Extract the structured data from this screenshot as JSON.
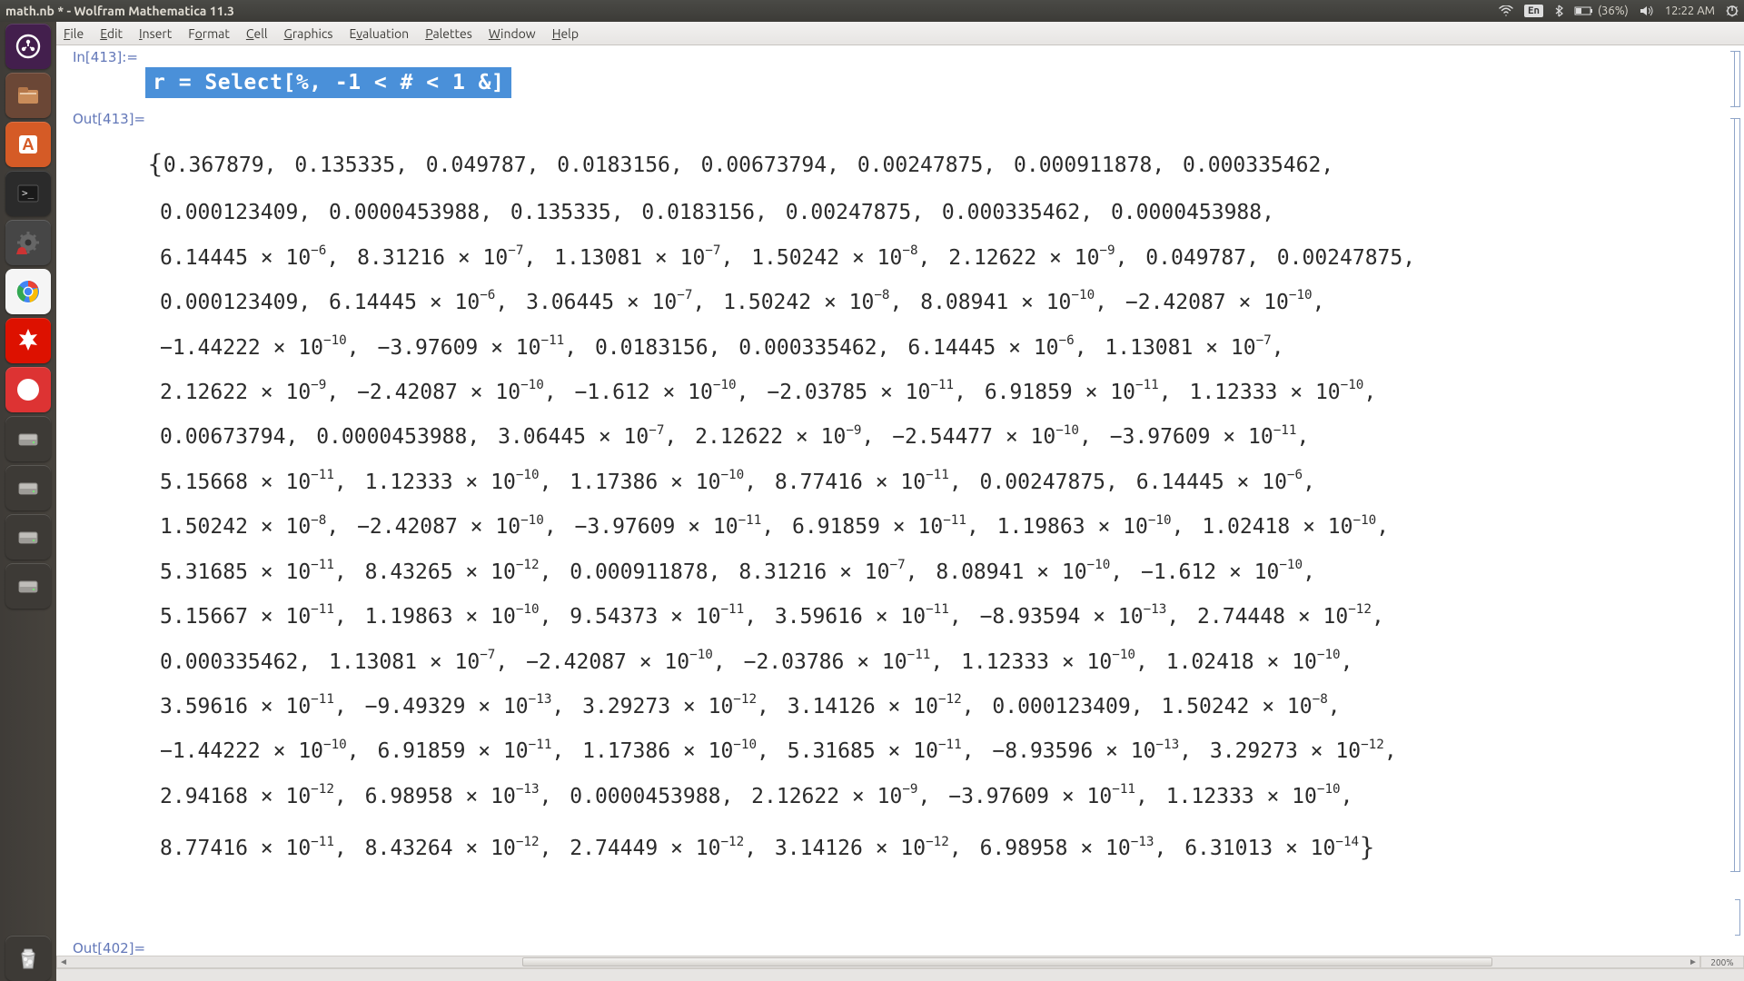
{
  "titlebar": {
    "title": "math.nb * - Wolfram Mathematica 11.3",
    "indicators": {
      "lang": "En",
      "battery": "(36%)",
      "time": "12:22 AM"
    }
  },
  "menubar": [
    "File",
    "Edit",
    "Insert",
    "Format",
    "Cell",
    "Graphics",
    "Evaluation",
    "Palettes",
    "Window",
    "Help"
  ],
  "launcher": {
    "items": [
      {
        "name": "dash-icon",
        "bg": "#431f4d"
      },
      {
        "name": "files-icon",
        "bg": "#6b4736"
      },
      {
        "name": "software-center-icon",
        "bg": "#d55b26"
      },
      {
        "name": "terminal-icon",
        "bg": "#2b2b2b"
      },
      {
        "name": "settings-icon",
        "bg": "#464646"
      },
      {
        "name": "chrome-icon",
        "bg": "#f5f5f5"
      },
      {
        "name": "mathematica-icon",
        "bg": "#dd1100"
      },
      {
        "name": "evince-icon",
        "bg": "#d33"
      },
      {
        "name": "drive-icon-1",
        "bg": "#3d3a36"
      },
      {
        "name": "drive-icon-2",
        "bg": "#3d3a36"
      },
      {
        "name": "drive-icon-3",
        "bg": "#3d3a36"
      },
      {
        "name": "drive-icon-4",
        "bg": "#3d3a36"
      }
    ],
    "trash": {
      "name": "trash-icon",
      "bg": "#3d3a36"
    }
  },
  "notebook": {
    "in_label": "In[413]:=",
    "input_code": "r = Select[%, -1 < # < 1 &]",
    "out_label": "Out[413]=",
    "out402_label": "Out[402]=",
    "zoom": "200%",
    "output_rows": [
      [
        {
          "t": "brace",
          "v": "{"
        },
        {
          "t": "n",
          "v": "0.367879"
        },
        {
          "t": "n",
          "v": "0.135335"
        },
        {
          "t": "n",
          "v": "0.049787"
        },
        {
          "t": "n",
          "v": "0.0183156"
        },
        {
          "t": "n",
          "v": "0.00673794"
        },
        {
          "t": "n",
          "v": "0.00247875"
        },
        {
          "t": "n",
          "v": "0.000911878"
        },
        {
          "t": "n",
          "v": "0.000335462"
        }
      ],
      [
        {
          "t": "n",
          "v": "0.000123409"
        },
        {
          "t": "n",
          "v": "0.0000453988"
        },
        {
          "t": "n",
          "v": "0.135335"
        },
        {
          "t": "n",
          "v": "0.0183156"
        },
        {
          "t": "n",
          "v": "0.00247875"
        },
        {
          "t": "n",
          "v": "0.000335462"
        },
        {
          "t": "n",
          "v": "0.0000453988"
        }
      ],
      [
        {
          "t": "s",
          "m": "6.14445",
          "e": "-6"
        },
        {
          "t": "s",
          "m": "8.31216",
          "e": "-7"
        },
        {
          "t": "s",
          "m": "1.13081",
          "e": "-7"
        },
        {
          "t": "s",
          "m": "1.50242",
          "e": "-8"
        },
        {
          "t": "s",
          "m": "2.12622",
          "e": "-9"
        },
        {
          "t": "n",
          "v": "0.049787"
        },
        {
          "t": "n",
          "v": "0.00247875"
        }
      ],
      [
        {
          "t": "n",
          "v": "0.000123409"
        },
        {
          "t": "s",
          "m": "6.14445",
          "e": "-6"
        },
        {
          "t": "s",
          "m": "3.06445",
          "e": "-7"
        },
        {
          "t": "s",
          "m": "1.50242",
          "e": "-8"
        },
        {
          "t": "s",
          "m": "8.08941",
          "e": "-10"
        },
        {
          "t": "s",
          "m": "-2.42087",
          "e": "-10"
        }
      ],
      [
        {
          "t": "s",
          "m": "-1.44222",
          "e": "-10"
        },
        {
          "t": "s",
          "m": "-3.97609",
          "e": "-11"
        },
        {
          "t": "n",
          "v": "0.0183156"
        },
        {
          "t": "n",
          "v": "0.000335462"
        },
        {
          "t": "s",
          "m": "6.14445",
          "e": "-6"
        },
        {
          "t": "s",
          "m": "1.13081",
          "e": "-7"
        }
      ],
      [
        {
          "t": "s",
          "m": "2.12622",
          "e": "-9"
        },
        {
          "t": "s",
          "m": "-2.42087",
          "e": "-10"
        },
        {
          "t": "s",
          "m": "-1.612",
          "e": "-10"
        },
        {
          "t": "s",
          "m": "-2.03785",
          "e": "-11"
        },
        {
          "t": "s",
          "m": "6.91859",
          "e": "-11"
        },
        {
          "t": "s",
          "m": "1.12333",
          "e": "-10"
        }
      ],
      [
        {
          "t": "n",
          "v": "0.00673794"
        },
        {
          "t": "n",
          "v": "0.0000453988"
        },
        {
          "t": "s",
          "m": "3.06445",
          "e": "-7"
        },
        {
          "t": "s",
          "m": "2.12622",
          "e": "-9"
        },
        {
          "t": "s",
          "m": "-2.54477",
          "e": "-10"
        },
        {
          "t": "s",
          "m": "-3.97609",
          "e": "-11"
        }
      ],
      [
        {
          "t": "s",
          "m": "5.15668",
          "e": "-11"
        },
        {
          "t": "s",
          "m": "1.12333",
          "e": "-10"
        },
        {
          "t": "s",
          "m": "1.17386",
          "e": "-10"
        },
        {
          "t": "s",
          "m": "8.77416",
          "e": "-11"
        },
        {
          "t": "n",
          "v": "0.00247875"
        },
        {
          "t": "s",
          "m": "6.14445",
          "e": "-6"
        }
      ],
      [
        {
          "t": "s",
          "m": "1.50242",
          "e": "-8"
        },
        {
          "t": "s",
          "m": "-2.42087",
          "e": "-10"
        },
        {
          "t": "s",
          "m": "-3.97609",
          "e": "-11"
        },
        {
          "t": "s",
          "m": "6.91859",
          "e": "-11"
        },
        {
          "t": "s",
          "m": "1.19863",
          "e": "-10"
        },
        {
          "t": "s",
          "m": "1.02418",
          "e": "-10"
        }
      ],
      [
        {
          "t": "s",
          "m": "5.31685",
          "e": "-11"
        },
        {
          "t": "s",
          "m": "8.43265",
          "e": "-12"
        },
        {
          "t": "n",
          "v": "0.000911878"
        },
        {
          "t": "s",
          "m": "8.31216",
          "e": "-7"
        },
        {
          "t": "s",
          "m": "8.08941",
          "e": "-10"
        },
        {
          "t": "s",
          "m": "-1.612",
          "e": "-10"
        }
      ],
      [
        {
          "t": "s",
          "m": "5.15667",
          "e": "-11"
        },
        {
          "t": "s",
          "m": "1.19863",
          "e": "-10"
        },
        {
          "t": "s",
          "m": "9.54373",
          "e": "-11"
        },
        {
          "t": "s",
          "m": "3.59616",
          "e": "-11"
        },
        {
          "t": "s",
          "m": "-8.93594",
          "e": "-13"
        },
        {
          "t": "s",
          "m": "2.74448",
          "e": "-12"
        }
      ],
      [
        {
          "t": "n",
          "v": "0.000335462"
        },
        {
          "t": "s",
          "m": "1.13081",
          "e": "-7"
        },
        {
          "t": "s",
          "m": "-2.42087",
          "e": "-10"
        },
        {
          "t": "s",
          "m": "-2.03786",
          "e": "-11"
        },
        {
          "t": "s",
          "m": "1.12333",
          "e": "-10"
        },
        {
          "t": "s",
          "m": "1.02418",
          "e": "-10"
        }
      ],
      [
        {
          "t": "s",
          "m": "3.59616",
          "e": "-11"
        },
        {
          "t": "s",
          "m": "-9.49329",
          "e": "-13"
        },
        {
          "t": "s",
          "m": "3.29273",
          "e": "-12"
        },
        {
          "t": "s",
          "m": "3.14126",
          "e": "-12"
        },
        {
          "t": "n",
          "v": "0.000123409"
        },
        {
          "t": "s",
          "m": "1.50242",
          "e": "-8"
        }
      ],
      [
        {
          "t": "s",
          "m": "-1.44222",
          "e": "-10"
        },
        {
          "t": "s",
          "m": "6.91859",
          "e": "-11"
        },
        {
          "t": "s",
          "m": "1.17386",
          "e": "-10"
        },
        {
          "t": "s",
          "m": "5.31685",
          "e": "-11"
        },
        {
          "t": "s",
          "m": "-8.93596",
          "e": "-13"
        },
        {
          "t": "s",
          "m": "3.29273",
          "e": "-12"
        }
      ],
      [
        {
          "t": "s",
          "m": "2.94168",
          "e": "-12"
        },
        {
          "t": "s",
          "m": "6.98958",
          "e": "-13"
        },
        {
          "t": "n",
          "v": "0.0000453988"
        },
        {
          "t": "s",
          "m": "2.12622",
          "e": "-9"
        },
        {
          "t": "s",
          "m": "-3.97609",
          "e": "-11"
        },
        {
          "t": "s",
          "m": "1.12333",
          "e": "-10"
        }
      ],
      [
        {
          "t": "s",
          "m": "8.77416",
          "e": "-11"
        },
        {
          "t": "s",
          "m": "8.43264",
          "e": "-12"
        },
        {
          "t": "s",
          "m": "2.74449",
          "e": "-12"
        },
        {
          "t": "s",
          "m": "3.14126",
          "e": "-12"
        },
        {
          "t": "s",
          "m": "6.98958",
          "e": "-13"
        },
        {
          "t": "s",
          "m": "6.31013",
          "e": "-14",
          "last": true
        },
        {
          "t": "brace",
          "v": "}"
        }
      ]
    ]
  }
}
